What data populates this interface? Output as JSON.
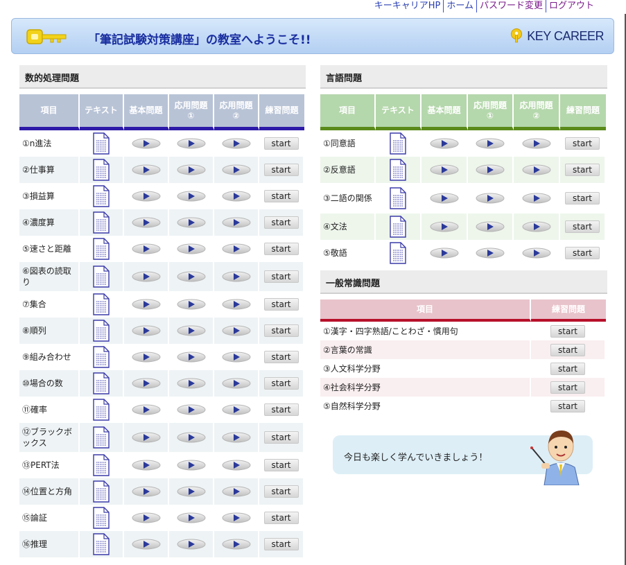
{
  "nav": {
    "links": [
      "キーキャリアHP",
      "ホーム",
      "パスワード変更",
      "ログアウト"
    ]
  },
  "banner": {
    "title": "「筆記試験対策講座」の教室へようこそ!!",
    "brand": "KEY CAREER"
  },
  "colors": {
    "math_header": "#b8c3d6",
    "math_accent": "#2d1aa8",
    "lang_header": "#b5d7ac",
    "lang_accent": "#5a8a1a",
    "gen_header": "#e8c3cb",
    "gen_accent": "#b8102a"
  },
  "math": {
    "title": "数的処理問題",
    "headers": [
      "項目",
      "テキスト",
      "基本問題",
      "応用問題\n①",
      "応用問題\n②",
      "練習問題"
    ],
    "items": [
      "①n進法",
      "②仕事算",
      "③損益算",
      "④濃度算",
      "⑤速さと距離",
      "⑥図表の読取り",
      "⑦集合",
      "⑧順列",
      "⑨組み合わせ",
      "⑩場合の数",
      "⑪確率",
      "⑫ブラックボックス",
      "⑬PERT法",
      "⑭位置と方角",
      "⑮論証",
      "⑯推理"
    ]
  },
  "lang": {
    "title": "言語問題",
    "headers": [
      "項目",
      "テキスト",
      "基本問題",
      "応用問題\n①",
      "応用問題\n②",
      "練習問題"
    ],
    "items": [
      "①同意語",
      "②反意語",
      "③二語の関係",
      "④文法",
      "⑤敬語"
    ]
  },
  "general": {
    "title": "一般常識問題",
    "headers": [
      "項目",
      "練習問題"
    ],
    "items": [
      "①漢字・四字熟語/ことわざ・慣用句",
      "②言葉の常識",
      "③人文科学分野",
      "④社会科学分野",
      "⑤自然科学分野"
    ]
  },
  "start_label": "start",
  "message": "今日も楽しく学んでいきましょう！",
  "icons": {
    "text": "document-icon",
    "play": "play-icon",
    "key": "key-icon",
    "teacher": "teacher-illustration"
  }
}
